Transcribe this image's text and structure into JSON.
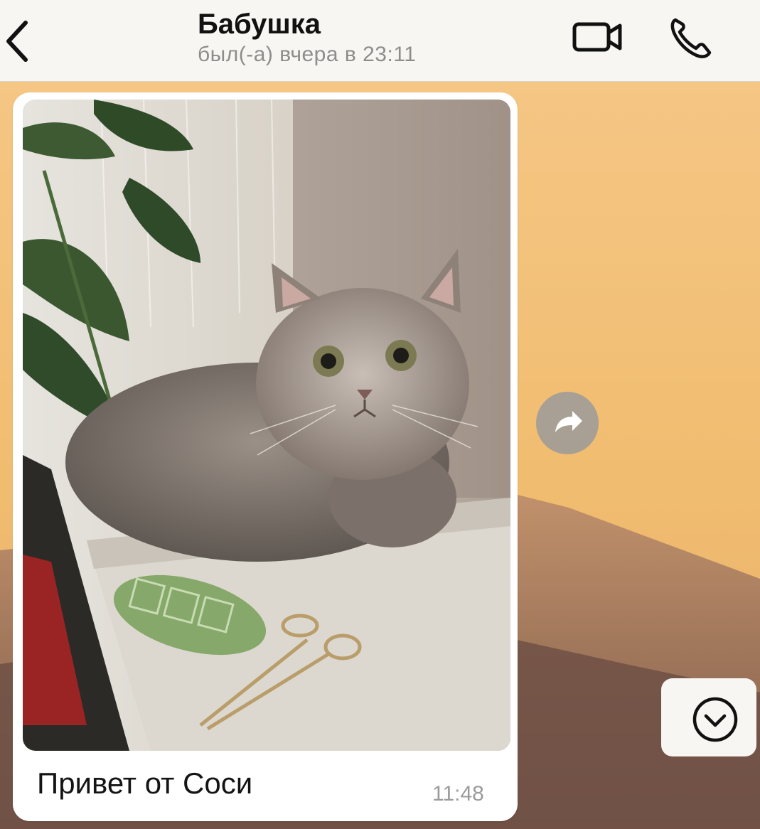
{
  "header": {
    "back_icon": "chevron-left-icon",
    "title": "Бабушка",
    "status": "был(-а) вчера в 23:11",
    "video_icon": "video-camera-icon",
    "call_icon": "phone-icon"
  },
  "message": {
    "caption": "Привет от Соси",
    "time": "11:48",
    "forward_icon": "forward-share-icon"
  },
  "scroll_down_icon": "chevron-down-circle-icon",
  "colors": {
    "header_bg": "#f7f6f2",
    "wallpaper_sky": "#f1c680",
    "wallpaper_ground": "#7a5a4c",
    "bubble_bg": "#ffffff"
  }
}
